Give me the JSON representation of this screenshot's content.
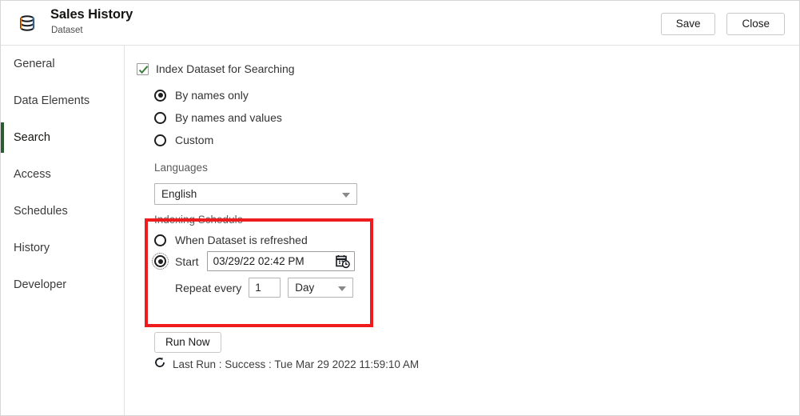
{
  "header": {
    "icon": "dataset-database-icon",
    "title": "Sales History",
    "subtitle": "Dataset",
    "save_label": "Save",
    "close_label": "Close"
  },
  "sidebar": {
    "items": [
      {
        "label": "General",
        "active": false
      },
      {
        "label": "Data Elements",
        "active": false
      },
      {
        "label": "Search",
        "active": true
      },
      {
        "label": "Access",
        "active": false
      },
      {
        "label": "Schedules",
        "active": false
      },
      {
        "label": "History",
        "active": false
      },
      {
        "label": "Developer",
        "active": false
      }
    ],
    "active_accent_color": "#2e5a34"
  },
  "main": {
    "index_checkbox": {
      "label": "Index Dataset for Searching",
      "checked": true,
      "check_color": "#3f7d3f"
    },
    "index_mode_options": [
      {
        "label": "By names only",
        "selected": true
      },
      {
        "label": "By names and values",
        "selected": false
      },
      {
        "label": "Custom",
        "selected": false
      }
    ],
    "languages": {
      "label": "Languages",
      "value": "English"
    },
    "indexing_schedule": {
      "title": "Indexing Schedule",
      "options": [
        {
          "label": "When Dataset is refreshed",
          "selected": false
        },
        {
          "label": "Start",
          "selected": true
        }
      ],
      "start_datetime": "03/29/22 02:42 PM",
      "calendar_icon": "calendar-clock-icon",
      "repeat_label": "Repeat every",
      "repeat_value": "1",
      "repeat_unit": "Day",
      "highlight_color": "#ee1c1c"
    },
    "run_now_label": "Run Now",
    "last_run": {
      "icon": "refresh-icon",
      "text": "Last Run : Success : Tue Mar 29 2022 11:59:10 AM"
    }
  }
}
